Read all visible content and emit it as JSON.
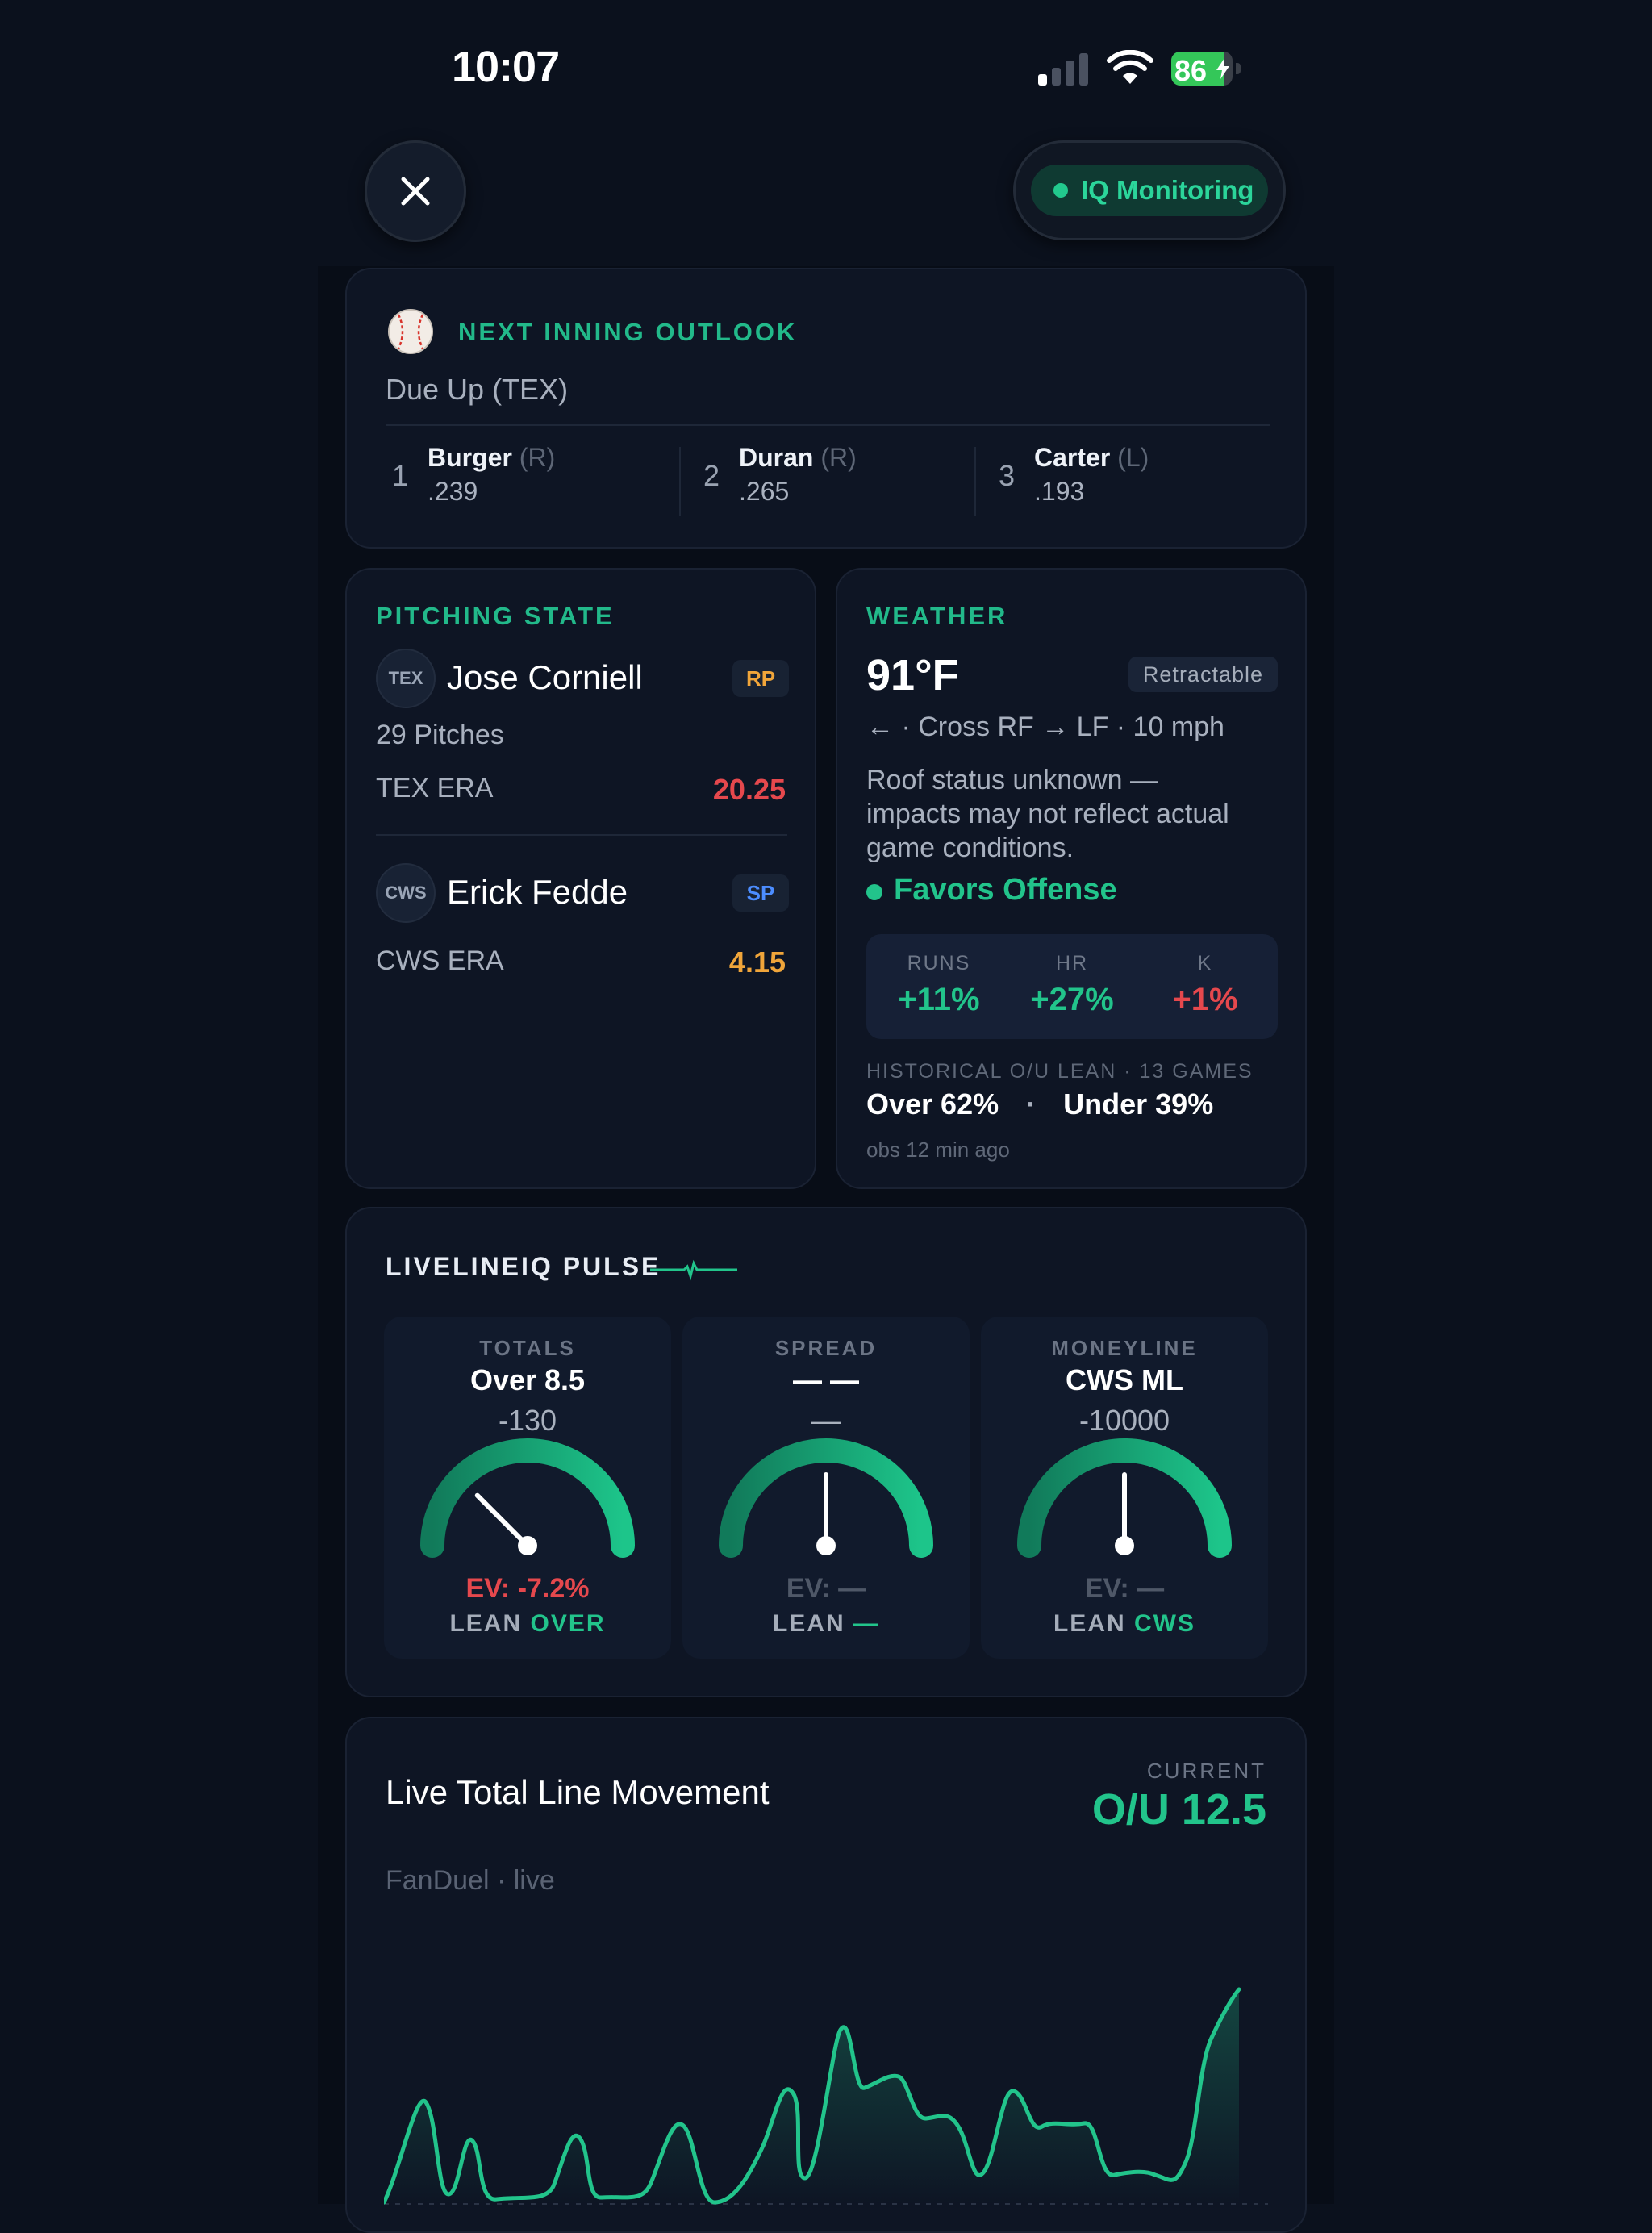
{
  "status_bar": {
    "time": "10:07",
    "battery": "86",
    "battery_level": 0.86
  },
  "header": {
    "monitor_label": "IQ Monitoring"
  },
  "next_inning": {
    "title": "NEXT INNING OUTLOOK",
    "subtitle": "Due Up (TEX)",
    "batters": [
      {
        "order": "1",
        "name": "Burger",
        "hand": "(R)",
        "avg": ".239"
      },
      {
        "order": "2",
        "name": "Duran",
        "hand": "(R)",
        "avg": ".265"
      },
      {
        "order": "3",
        "name": "Carter",
        "hand": "(L)",
        "avg": ".193"
      }
    ]
  },
  "pitching": {
    "title": "PITCHING STATE",
    "current": {
      "team": "TEX",
      "name": "Jose Corniell",
      "role": "RP",
      "pitches": "29 Pitches",
      "era_label": "TEX ERA",
      "era": "20.25"
    },
    "opponent": {
      "team": "CWS",
      "name": "Erick Fedde",
      "role": "SP",
      "era_label": "CWS ERA",
      "era": "4.15"
    }
  },
  "weather": {
    "title": "WEATHER",
    "temp": "91°F",
    "roof_tag": "Retractable",
    "wind": "← · Cross RF → LF · 10 mph",
    "note_lines": [
      "Roof status unknown —",
      "impacts may not reflect actual",
      "game conditions."
    ],
    "verdict": "Favors Offense",
    "metrics": [
      {
        "label": "RUNS",
        "value": "+11%",
        "color": "#22c48b"
      },
      {
        "label": "HR",
        "value": "+27%",
        "color": "#22c48b"
      },
      {
        "label": "K",
        "value": "+1%",
        "color": "#e5484d"
      }
    ],
    "history_label": "HISTORICAL O/U LEAN · 13 GAMES",
    "over": "Over 62%",
    "dot": "·",
    "under": "Under 39%",
    "obs": "obs 12 min ago"
  },
  "pulse": {
    "title": "LIVELINEIQ PULSE",
    "gauges": [
      {
        "title": "TOTALS",
        "pick": "Over 8.5",
        "odds": "-130",
        "ev": "EV: -7.2%",
        "ev_color": "#e5484d",
        "lean_prefix": "LEAN",
        "lean_pick": "OVER",
        "needle_deg": -45
      },
      {
        "title": "SPREAD",
        "pick": "— —",
        "odds": "—",
        "ev": "EV: —",
        "ev_color": "#4f5868",
        "lean_prefix": "LEAN",
        "lean_pick": "—",
        "needle_deg": 0
      },
      {
        "title": "MONEYLINE",
        "pick": "CWS ML",
        "odds": "-10000",
        "ev": "EV: —",
        "ev_color": "#4f5868",
        "lean_prefix": "LEAN",
        "lean_pick": "CWS",
        "needle_deg": 0
      }
    ]
  },
  "line_movement": {
    "title": "Live Total Line Movement",
    "current_label": "CURRENT",
    "current_value": "O/U 12.5",
    "source": "FanDuel · live"
  },
  "colors": {
    "accent": "#22c48b",
    "danger": "#e5484d",
    "warning": "#f0a53a",
    "info": "#4c8dff"
  }
}
